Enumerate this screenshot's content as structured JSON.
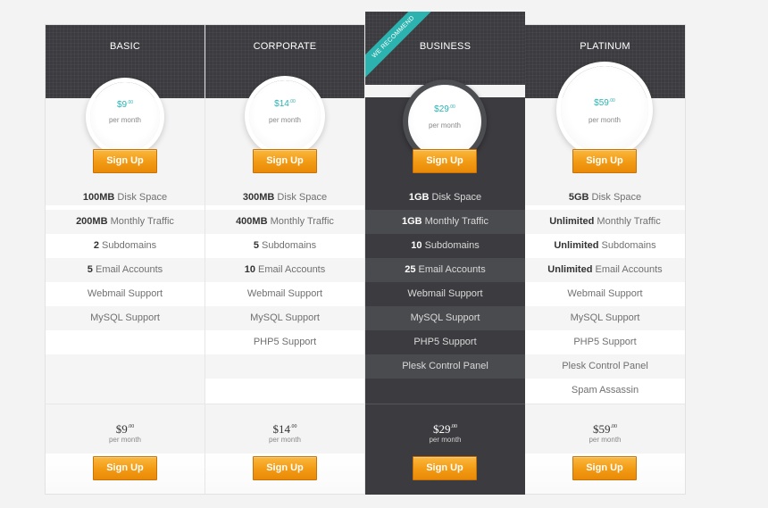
{
  "per_month": "per month",
  "signup_label": "Sign Up",
  "colors": {
    "accent": "#2ab3b1",
    "button": "#f29a13",
    "dark": "#3c3c40"
  },
  "plans": [
    {
      "name": "BASIC",
      "price": "$9",
      "cents": ".00",
      "features": [
        {
          "bold": "100MB",
          "text": " Disk Space"
        },
        {
          "bold": "200MB",
          "text": " Monthly Traffic"
        },
        {
          "bold": "2",
          "text": " Subdomains"
        },
        {
          "bold": "5",
          "text": " Email Accounts"
        },
        {
          "bold": "",
          "text": "Webmail Support"
        },
        {
          "bold": "",
          "text": "MySQL Support"
        }
      ]
    },
    {
      "name": "CORPORATE",
      "price": "$14",
      "cents": ".00",
      "features": [
        {
          "bold": "300MB",
          "text": " Disk Space"
        },
        {
          "bold": "400MB",
          "text": " Monthly Traffic"
        },
        {
          "bold": "5",
          "text": " Subdomains"
        },
        {
          "bold": "10",
          "text": " Email Accounts"
        },
        {
          "bold": "",
          "text": "Webmail Support"
        },
        {
          "bold": "",
          "text": "MySQL Support"
        },
        {
          "bold": "",
          "text": "PHP5 Support"
        }
      ]
    },
    {
      "name": "BUSINESS",
      "ribbon": "WE RECOMMEND",
      "price": "$29",
      "cents": ".00",
      "features": [
        {
          "bold": "1GB",
          "text": " Disk Space"
        },
        {
          "bold": "1GB",
          "text": " Monthly Traffic"
        },
        {
          "bold": "10",
          "text": " Subdomains"
        },
        {
          "bold": "25",
          "text": " Email Accounts"
        },
        {
          "bold": "",
          "text": "Webmail Support"
        },
        {
          "bold": "",
          "text": "MySQL Support"
        },
        {
          "bold": "",
          "text": "PHP5 Support"
        },
        {
          "bold": "",
          "text": "Plesk Control Panel"
        }
      ]
    },
    {
      "name": "PLATINUM",
      "price": "$59",
      "cents": ".00",
      "features": [
        {
          "bold": "5GB",
          "text": " Disk Space"
        },
        {
          "bold": "Unlimited",
          "text": " Monthly Traffic"
        },
        {
          "bold": "Unlimited",
          "text": " Subdomains"
        },
        {
          "bold": "Unlimited",
          "text": " Email Accounts"
        },
        {
          "bold": "",
          "text": "Webmail Support"
        },
        {
          "bold": "",
          "text": "MySQL Support"
        },
        {
          "bold": "",
          "text": "PHP5 Support"
        },
        {
          "bold": "",
          "text": "Plesk Control Panel"
        },
        {
          "bold": "",
          "text": "Spam Assassin"
        }
      ]
    }
  ]
}
